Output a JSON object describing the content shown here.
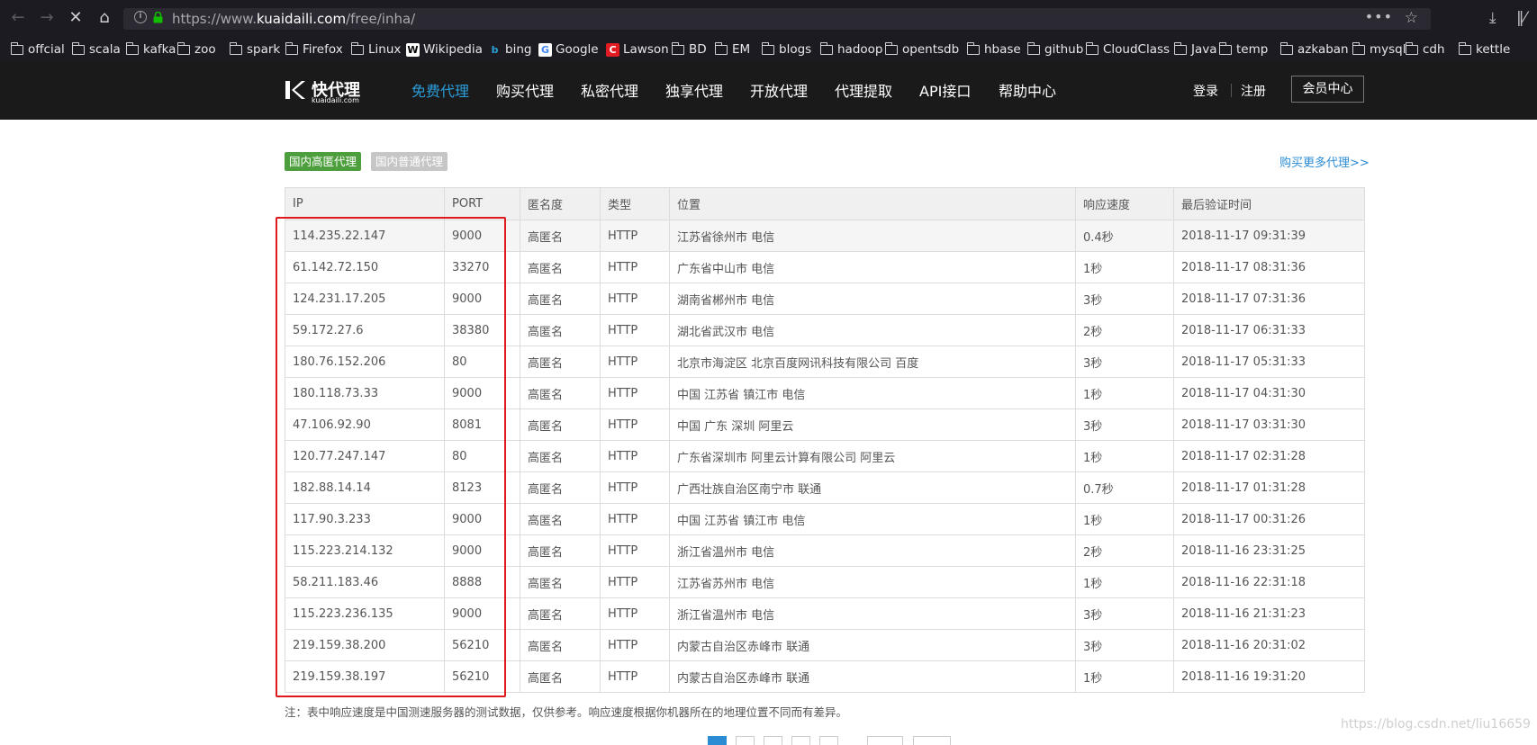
{
  "browser": {
    "url_prefix": "https://www.",
    "url_domain": "kuaidaili.com",
    "url_path": "/free/inha/",
    "bookmarks": [
      {
        "label": "offcial",
        "icon": "folder-icon"
      },
      {
        "label": "scala",
        "icon": "folder-icon"
      },
      {
        "label": "kafka",
        "icon": "folder-icon"
      },
      {
        "label": "zoo",
        "icon": "folder-icon"
      },
      {
        "label": "spark",
        "icon": "folder-icon"
      },
      {
        "label": "Firefox",
        "icon": "folder-icon"
      },
      {
        "label": "Linux",
        "icon": "folder-icon"
      },
      {
        "label": "Wikipedia",
        "icon": "wikipedia-icon"
      },
      {
        "label": "bing",
        "icon": "bing-icon"
      },
      {
        "label": "Google",
        "icon": "google-icon"
      },
      {
        "label": "Lawson",
        "icon": "lawson-icon"
      },
      {
        "label": "BD",
        "icon": "folder-icon"
      },
      {
        "label": "EM",
        "icon": "folder-icon"
      },
      {
        "label": "blogs",
        "icon": "folder-icon"
      },
      {
        "label": "hadoop",
        "icon": "folder-icon"
      },
      {
        "label": "opentsdb",
        "icon": "folder-icon"
      },
      {
        "label": "hbase",
        "icon": "folder-icon"
      },
      {
        "label": "github",
        "icon": "folder-icon"
      },
      {
        "label": "CloudClass",
        "icon": "folder-icon"
      },
      {
        "label": "Java",
        "icon": "folder-icon"
      },
      {
        "label": "temp",
        "icon": "folder-icon"
      },
      {
        "label": "azkaban",
        "icon": "folder-icon"
      },
      {
        "label": "mysql",
        "icon": "folder-icon"
      },
      {
        "label": "cdh",
        "icon": "folder-icon"
      },
      {
        "label": "kettle",
        "icon": "folder-icon"
      }
    ]
  },
  "site": {
    "logo_cn": "快代理",
    "logo_en": "kuaidaili.com",
    "nav": [
      "免费代理",
      "购买代理",
      "私密代理",
      "独享代理",
      "开放代理",
      "代理提取",
      "API接口",
      "帮助中心"
    ],
    "active_nav": "免费代理",
    "login": "登录",
    "register": "注册",
    "member_center": "会员中心"
  },
  "content": {
    "tab_high_anon": "国内高匿代理",
    "tab_normal": "国内普通代理",
    "buy_more": "购买更多代理>>",
    "columns": [
      "IP",
      "PORT",
      "匿名度",
      "类型",
      "位置",
      "响应速度",
      "最后验证时间"
    ],
    "rows": [
      [
        "114.235.22.147",
        "9000",
        "高匿名",
        "HTTP",
        "江苏省徐州市 电信",
        "0.4秒",
        "2018-11-17 09:31:39"
      ],
      [
        "61.142.72.150",
        "33270",
        "高匿名",
        "HTTP",
        "广东省中山市 电信",
        "1秒",
        "2018-11-17 08:31:36"
      ],
      [
        "124.231.17.205",
        "9000",
        "高匿名",
        "HTTP",
        "湖南省郴州市 电信",
        "3秒",
        "2018-11-17 07:31:36"
      ],
      [
        "59.172.27.6",
        "38380",
        "高匿名",
        "HTTP",
        "湖北省武汉市 电信",
        "2秒",
        "2018-11-17 06:31:33"
      ],
      [
        "180.76.152.206",
        "80",
        "高匿名",
        "HTTP",
        "北京市海淀区 北京百度网讯科技有限公司 百度",
        "3秒",
        "2018-11-17 05:31:33"
      ],
      [
        "180.118.73.33",
        "9000",
        "高匿名",
        "HTTP",
        "中国 江苏省 镇江市 电信",
        "1秒",
        "2018-11-17 04:31:30"
      ],
      [
        "47.106.92.90",
        "8081",
        "高匿名",
        "HTTP",
        "中国 广东 深圳 阿里云",
        "3秒",
        "2018-11-17 03:31:30"
      ],
      [
        "120.77.247.147",
        "80",
        "高匿名",
        "HTTP",
        "广东省深圳市 阿里云计算有限公司 阿里云",
        "1秒",
        "2018-11-17 02:31:28"
      ],
      [
        "182.88.14.14",
        "8123",
        "高匿名",
        "HTTP",
        "广西壮族自治区南宁市 联通",
        "0.7秒",
        "2018-11-17 01:31:28"
      ],
      [
        "117.90.3.233",
        "9000",
        "高匿名",
        "HTTP",
        "中国 江苏省 镇江市 电信",
        "1秒",
        "2018-11-17 00:31:26"
      ],
      [
        "115.223.214.132",
        "9000",
        "高匿名",
        "HTTP",
        "浙江省温州市 电信",
        "2秒",
        "2018-11-16 23:31:25"
      ],
      [
        "58.211.183.46",
        "8888",
        "高匿名",
        "HTTP",
        "江苏省苏州市 电信",
        "1秒",
        "2018-11-16 22:31:18"
      ],
      [
        "115.223.236.135",
        "9000",
        "高匿名",
        "HTTP",
        "浙江省温州市 电信",
        "3秒",
        "2018-11-16 21:31:23"
      ],
      [
        "219.159.38.200",
        "56210",
        "高匿名",
        "HTTP",
        "内蒙古自治区赤峰市 联通",
        "3秒",
        "2018-11-16 20:31:02"
      ],
      [
        "219.159.38.197",
        "56210",
        "高匿名",
        "HTTP",
        "内蒙古自治区赤峰市 联通",
        "1秒",
        "2018-11-16 19:31:20"
      ]
    ],
    "note": "注：表中响应速度是中国测速服务器的测试数据，仅供参考。响应速度根据你机器所在的地理位置不同而有差异。"
  },
  "watermark": "https://blog.csdn.net/liu16659",
  "colors": {
    "active_nav": "#2b9dd9",
    "tab_active": "#4d9e3c",
    "highlight_box": "#e0191c",
    "link": "#2b8cd4"
  }
}
